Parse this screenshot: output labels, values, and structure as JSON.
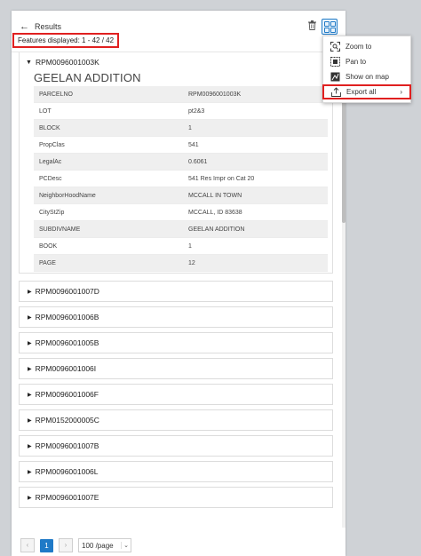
{
  "header": {
    "title": "Results",
    "features_displayed": "Features displayed: 1 - 42 / 42"
  },
  "expanded": {
    "id": "RPM0096001003K",
    "title": "GEELAN ADDITION",
    "rows": [
      {
        "key": "PARCELNO",
        "value": "RPM0096001003K"
      },
      {
        "key": "LOT",
        "value": "pt2&3"
      },
      {
        "key": "BLOCK",
        "value": "1"
      },
      {
        "key": "PropClas",
        "value": "541"
      },
      {
        "key": "LegalAc",
        "value": "0.6061"
      },
      {
        "key": "PCDesc",
        "value": "541 Res Impr on Cat 20"
      },
      {
        "key": "NeighborHoodName",
        "value": "MCCALL IN TOWN"
      },
      {
        "key": "CityStZip",
        "value": "MCCALL, ID 83638"
      },
      {
        "key": "SUBDIVNAME",
        "value": "GEELAN ADDITION"
      },
      {
        "key": "BOOK",
        "value": "1"
      },
      {
        "key": "PAGE",
        "value": "12"
      }
    ]
  },
  "collapsed": [
    "RPM0096001007D",
    "RPM0096001006B",
    "RPM0096001005B",
    "RPM0096001006I",
    "RPM0096001006F",
    "RPM0152000005C",
    "RPM0096001007B",
    "RPM0096001006L",
    "RPM0096001007E"
  ],
  "menu": {
    "zoom_to": "Zoom to",
    "pan_to": "Pan to",
    "show_on_map": "Show on map",
    "export_all": "Export all"
  },
  "pagination": {
    "current_page": "1",
    "page_size": "100 /page"
  },
  "colors": {
    "accent": "#1f7ac7",
    "highlight_outline": "#e02020"
  }
}
